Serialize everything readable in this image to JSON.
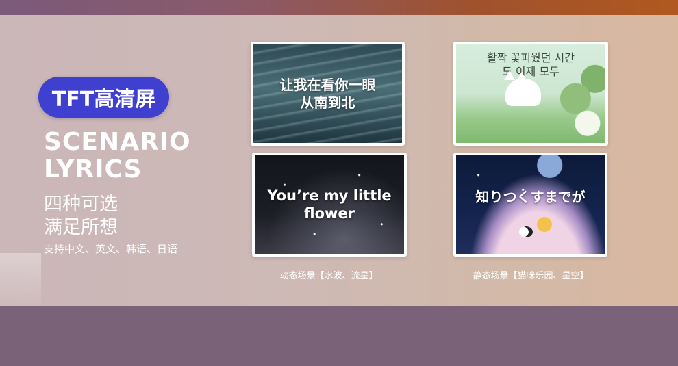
{
  "badge": {
    "label": "TFT高清屏"
  },
  "heading": {
    "line1": "SCENARIO",
    "line2": "LYRICS"
  },
  "subtitle": {
    "line1": "四种可选",
    "line2": "满足所想"
  },
  "support_text": "支持中文、英文、韩语、日语",
  "cards": {
    "water": {
      "line1": "让我在看你一眼",
      "line2": "从南到北"
    },
    "garden": {
      "line1": "활짝 꽃피웠던 시간",
      "line2": "도 이제 모두"
    },
    "night": {
      "line1": "You’re my little",
      "line2": "flower"
    },
    "space": {
      "line1": "知りつくすまでが"
    }
  },
  "captions": {
    "dynamic": "动态场景【水波、流星】",
    "static": "静态场景【猫咪乐园、星空】"
  },
  "colors": {
    "badge_bg": "#3f3fd0",
    "panel_bg": "#cdb9b6",
    "bottom_band": "#7a6378"
  }
}
